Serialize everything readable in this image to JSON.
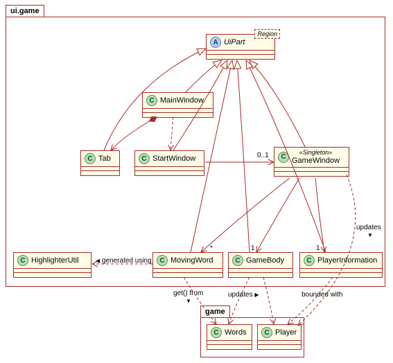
{
  "packages": {
    "uigame": {
      "label": "ui.game"
    },
    "game": {
      "label": "game"
    }
  },
  "classes": {
    "uipart": {
      "name": "UiPart",
      "generic": "Region",
      "kind": "A"
    },
    "mainwindow": {
      "name": "MainWindow",
      "kind": "C"
    },
    "tab": {
      "name": "Tab",
      "kind": "C"
    },
    "startwindow": {
      "name": "StartWindow",
      "kind": "C"
    },
    "gamewindow": {
      "name": "GameWindow",
      "stereotype": "«Singleton»",
      "kind": "C"
    },
    "highlighterutil": {
      "name": "HighlighterUtil",
      "kind": "C"
    },
    "movingword": {
      "name": "MovingWord",
      "kind": "C"
    },
    "gamebody": {
      "name": "GameBody",
      "kind": "C"
    },
    "playerinformation": {
      "name": "PlayerInformation",
      "kind": "C"
    },
    "words": {
      "name": "Words",
      "kind": "C"
    },
    "player": {
      "name": "Player",
      "kind": "C"
    }
  },
  "labels": {
    "generated_using": "generated using",
    "get_from": "get() from",
    "updates": "updates",
    "bounded_with": "bounded with",
    "mult_0_1": "0..1",
    "mult_star": "*",
    "mult_1a": "1",
    "mult_1b": "1"
  },
  "chart_data": {
    "type": "uml_class_diagram",
    "packages": [
      {
        "name": "ui.game",
        "contains": [
          "UiPart",
          "MainWindow",
          "Tab",
          "StartWindow",
          "GameWindow",
          "HighlighterUtil",
          "MovingWord",
          "GameBody",
          "PlayerInformation"
        ]
      },
      {
        "name": "game",
        "contains": [
          "Words",
          "Player"
        ]
      }
    ],
    "classes": [
      {
        "name": "UiPart",
        "abstract": true,
        "template_param": "Region"
      },
      {
        "name": "MainWindow"
      },
      {
        "name": "Tab"
      },
      {
        "name": "StartWindow"
      },
      {
        "name": "GameWindow",
        "stereotype": "Singleton"
      },
      {
        "name": "HighlighterUtil"
      },
      {
        "name": "MovingWord"
      },
      {
        "name": "GameBody"
      },
      {
        "name": "PlayerInformation"
      },
      {
        "name": "Words"
      },
      {
        "name": "Player"
      }
    ],
    "relations": [
      {
        "from": "MainWindow",
        "to": "UiPart",
        "type": "generalization"
      },
      {
        "from": "Tab",
        "to": "UiPart",
        "type": "generalization"
      },
      {
        "from": "StartWindow",
        "to": "UiPart",
        "type": "generalization"
      },
      {
        "from": "GameWindow",
        "to": "UiPart",
        "type": "generalization"
      },
      {
        "from": "MovingWord",
        "to": "UiPart",
        "type": "generalization"
      },
      {
        "from": "GameBody",
        "to": "UiPart",
        "type": "generalization"
      },
      {
        "from": "PlayerInformation",
        "to": "UiPart",
        "type": "generalization"
      },
      {
        "from": "MainWindow",
        "to": "Tab",
        "type": "composition"
      },
      {
        "from": "MainWindow",
        "to": "StartWindow",
        "type": "dependency"
      },
      {
        "from": "StartWindow",
        "to": "GameWindow",
        "type": "association",
        "multiplicity_to": "0..1"
      },
      {
        "from": "GameWindow",
        "to": "MovingWord",
        "type": "association",
        "multiplicity_to": "*"
      },
      {
        "from": "GameWindow",
        "to": "GameBody",
        "type": "association",
        "multiplicity_to": "1"
      },
      {
        "from": "GameWindow",
        "to": "PlayerInformation",
        "type": "association",
        "multiplicity_to": "1"
      },
      {
        "from": "MovingWord",
        "to": "HighlighterUtil",
        "type": "dependency",
        "label": "generated using"
      },
      {
        "from": "MovingWord",
        "to": "Words",
        "type": "dependency",
        "label": "get() from"
      },
      {
        "from": "GameBody",
        "to": "Words",
        "type": "dependency",
        "label": "updates"
      },
      {
        "from": "GameBody",
        "to": "Player",
        "type": "dependency",
        "label": "updates"
      },
      {
        "from": "PlayerInformation",
        "to": "Player",
        "type": "dependency",
        "label": "bounded with"
      },
      {
        "from": "GameWindow",
        "to": "Player",
        "type": "dependency",
        "label": "updates"
      }
    ]
  }
}
